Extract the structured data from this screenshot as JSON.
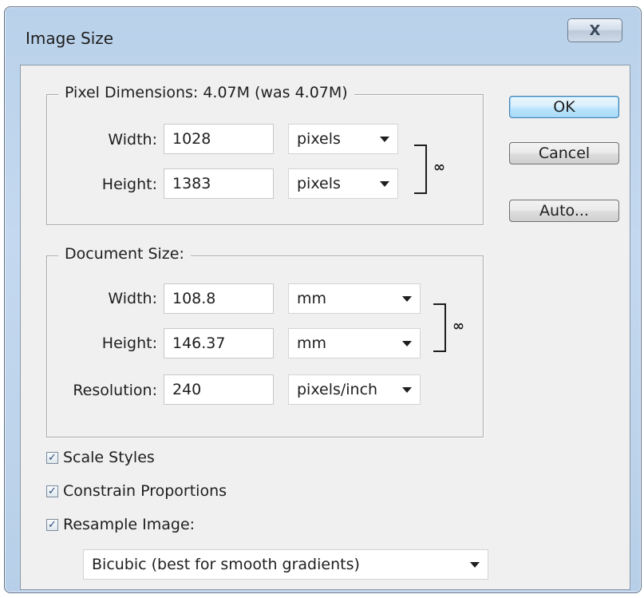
{
  "window": {
    "title": "Image Size",
    "close_glyph": "X"
  },
  "pixel_dimensions": {
    "title": "Pixel Dimensions:  4.07M (was 4.07M)",
    "width_label": "Width:",
    "width_value": "1028",
    "width_unit": "pixels",
    "height_label": "Height:",
    "height_value": "1383",
    "height_unit": "pixels"
  },
  "document_size": {
    "title": "Document Size:",
    "width_label": "Width:",
    "width_value": "108.8",
    "width_unit": "mm",
    "height_label": "Height:",
    "height_value": "146.37",
    "height_unit": "mm",
    "resolution_label": "Resolution:",
    "resolution_value": "240",
    "resolution_unit": "pixels/inch"
  },
  "buttons": {
    "ok": "OK",
    "cancel": "Cancel",
    "auto": "Auto..."
  },
  "options": {
    "scale_styles": {
      "label": "Scale Styles",
      "checked": true
    },
    "constrain_proportions": {
      "label": "Constrain Proportions",
      "checked": true
    },
    "resample_image": {
      "label": "Resample Image:",
      "checked": true
    },
    "resample_method": "Bicubic (best for smooth gradients)"
  },
  "icons": {
    "close": "close-icon",
    "link": "chain-link-icon",
    "dropdown": "chevron-down-icon",
    "check": "checkmark-icon"
  },
  "colors": {
    "frame": "#b9d1ea",
    "client": "#f0f0f0",
    "default_button": "#bee6fd"
  }
}
